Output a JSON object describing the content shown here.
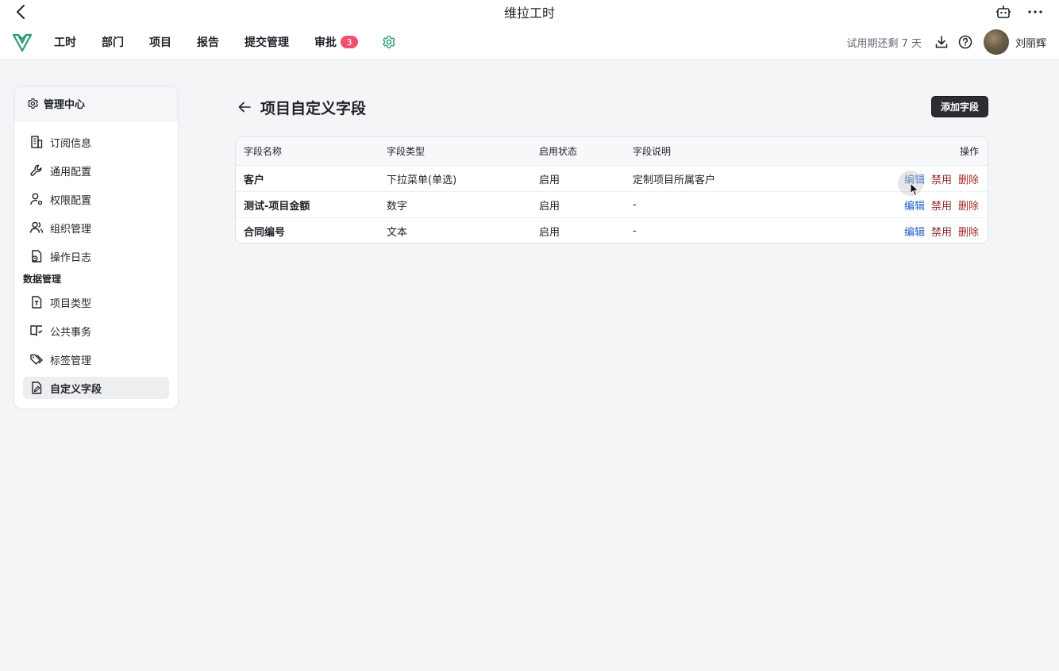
{
  "window": {
    "title": "维拉工时"
  },
  "nav": {
    "items": [
      {
        "label": "工时"
      },
      {
        "label": "部门"
      },
      {
        "label": "项目"
      },
      {
        "label": "报告"
      },
      {
        "label": "提交管理"
      },
      {
        "label": "审批",
        "badge": "3"
      }
    ],
    "trial_text": "试用期还剩 7 天",
    "username": "刘丽辉"
  },
  "sidebar": {
    "header": "管理中心",
    "items_top": [
      {
        "label": "订阅信息",
        "icon": "building-icon"
      },
      {
        "label": "通用配置",
        "icon": "wrench-icon"
      },
      {
        "label": "权限配置",
        "icon": "user-settings-icon"
      },
      {
        "label": "组织管理",
        "icon": "users-icon"
      },
      {
        "label": "操作日志",
        "icon": "log-icon"
      }
    ],
    "group_label": "数据管理",
    "items_data": [
      {
        "label": "项目类型",
        "icon": "file-type-icon"
      },
      {
        "label": "公共事务",
        "icon": "book-icon"
      },
      {
        "label": "标签管理",
        "icon": "tags-icon"
      },
      {
        "label": "自定义字段",
        "icon": "file-edit-icon",
        "active": true
      }
    ]
  },
  "main": {
    "title": "项目自定义字段",
    "add_button": "添加字段",
    "columns": [
      "字段名称",
      "字段类型",
      "启用状态",
      "字段说明",
      "操作"
    ],
    "rows": [
      {
        "name": "客户",
        "type": "下拉菜单(单选)",
        "status": "启用",
        "desc": "定制项目所属客户"
      },
      {
        "name": "测试-项目金额",
        "type": "数字",
        "status": "启用",
        "desc": "-"
      },
      {
        "name": "合同编号",
        "type": "文本",
        "status": "启用",
        "desc": "-"
      }
    ],
    "actions": {
      "edit": "编辑",
      "disable": "禁用",
      "delete": "删除"
    }
  },
  "colors": {
    "accent": "#1f5fc4",
    "danger": "#a62626",
    "badge": "#f0506e",
    "brand": "#2a9d6f"
  }
}
